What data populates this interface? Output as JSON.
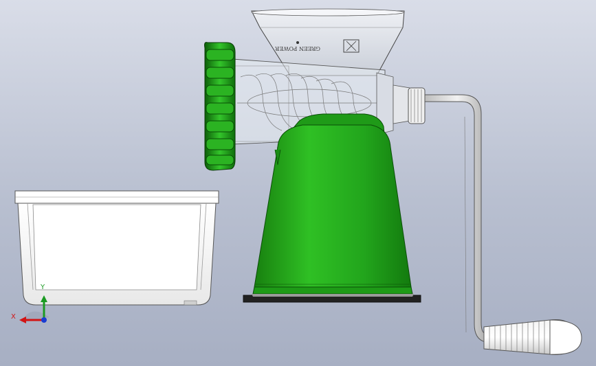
{
  "viewport": {
    "background_top": "#d9dde8",
    "background_bottom": "#a7afc3"
  },
  "model": {
    "hopper_marking": "GREEN POWER",
    "colors": {
      "body_green": "#22a51c",
      "body_green_dark": "#0f6e0c",
      "base_rim": "#222222",
      "tray_white": "#f8f8f8",
      "metal": "#dcdcdc"
    }
  },
  "triad": {
    "x_label": "X",
    "y_label": "Y",
    "x_color": "#d21414",
    "y_color": "#1a9a22",
    "z_color": "#1a3cd2"
  }
}
